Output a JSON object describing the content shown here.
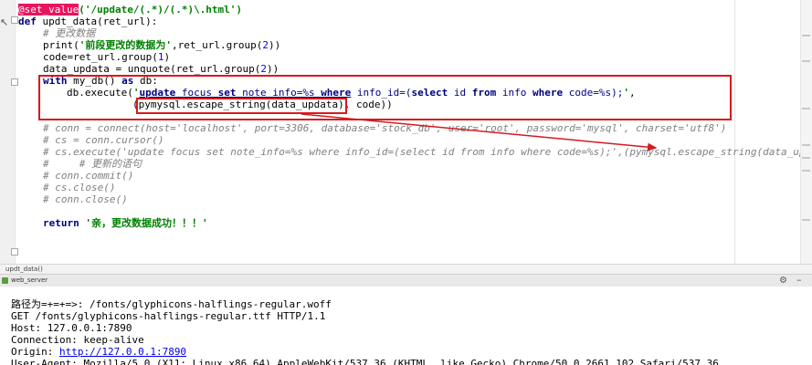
{
  "editor": {
    "decorator": "@set_value",
    "decorator_args": "('/update/(.*)/(.*)\\.html')",
    "def_kw": "def",
    "def_sig": " updt_data(ret_url):",
    "comment1": "# 更改数据",
    "print_pre": "print(",
    "print_str": "'前段更改的数据为'",
    "print_post": ",ret_url.group(",
    "num2": "2",
    "close_paren2": "))",
    "code_line": "code=ret_url.group(",
    "num1": "1",
    "close_paren1": ")",
    "data_line": "data_updata = unquote(ret_url.group(",
    "with_kw": "with",
    "with_mid": " my_db() ",
    "as_kw": "as",
    "with_end": " db:",
    "exec_pre": "db.execute(",
    "sql_quote_open": "'",
    "sql_update": "update",
    "sql_focus": " focus ",
    "sql_set": "set",
    "sql_note": " note_info=%s ",
    "sql_where1": "where",
    "sql_info": " info_id=(",
    "sql_select": "select",
    "sql_id": " id ",
    "sql_from": "from",
    "sql_info2": " info ",
    "sql_where2": "where",
    "sql_code": " code=%s);",
    "sql_quote_close": "'",
    "exec_comma": ",",
    "escape_open": "(",
    "escape_call": "pymysql.escape_string(data_updata)",
    "escape_rest": ", code))",
    "c_conn": "# conn = connect(host='localhost', port=3306, database='stock_db', user='root', password='mysql', charset='utf8')",
    "c_cs": "# cs = conn.cursor()",
    "c_exec": "# cs.execute('update focus set note_info=%s where info_id=(select id from info where code=%s);',(pymysql.escape_string(data_upda",
    "c_note": "#     # 更新的语句",
    "c_commit": "# conn.commit()",
    "c_csclose": "# cs.close()",
    "c_connclose": "# conn.close()",
    "return_kw": "return",
    "return_str": " '亲，更改数据成功！！！'"
  },
  "breadcrumb": {
    "label": "updt_data()"
  },
  "run_panel": {
    "label": "web_server"
  },
  "console": {
    "line1": "路径为=+=+=>: /fonts/glyphicons-halflings-regular.woff",
    "line2": "GET /fonts/glyphicons-halflings-regular.ttf HTTP/1.1",
    "line3": "Host: 127.0.0.1:7890",
    "line4": "Connection: keep-alive",
    "origin_label": "Origin: ",
    "origin_link": "http://127.0.0.1:7890",
    "line6": "User-Agent: Mozilla/5.0 (X11; Linux x86_64) AppleWebKit/537.36 (KHTML, like Gecko) Chrome/50.0.2661.102 Safari/537.36"
  },
  "colors": {
    "annotation": "#d71920",
    "decorator_bg": "#e8145e",
    "keyword": "#000080",
    "string": "#008000",
    "comment": "#808080"
  },
  "icons": {
    "run": "run-icon",
    "settings": "gear-icon",
    "hide": "minimize-icon",
    "pointer": "cursor-icon"
  }
}
